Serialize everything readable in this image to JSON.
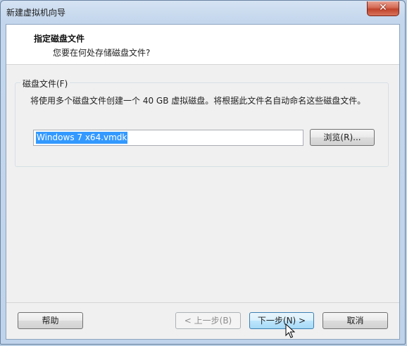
{
  "window": {
    "title": "新建虚拟机向导",
    "close_symbol": "✕"
  },
  "header": {
    "title": "指定磁盘文件",
    "subtitle": "您要在何处存储磁盘文件?"
  },
  "disk_file": {
    "group_label": "磁盘文件(F)",
    "description": "将使用多个磁盘文件创建一个 40 GB 虚拟磁盘。将根据此文件名自动命名这些磁盘文件。",
    "file_name": "Windows 7 x64.vmdk",
    "browse_label": "浏览(R)..."
  },
  "footer": {
    "help_label": "帮助",
    "back_label": "< 上一步(B)",
    "next_label": "下一步(N) >",
    "cancel_label": "取消"
  },
  "icons": {
    "close": "close-icon",
    "cursor": "mouse-pointer-icon"
  },
  "colors": {
    "selection": "#3399ff",
    "close_button": "#c1432b",
    "hover_button": "#bee6fd"
  }
}
